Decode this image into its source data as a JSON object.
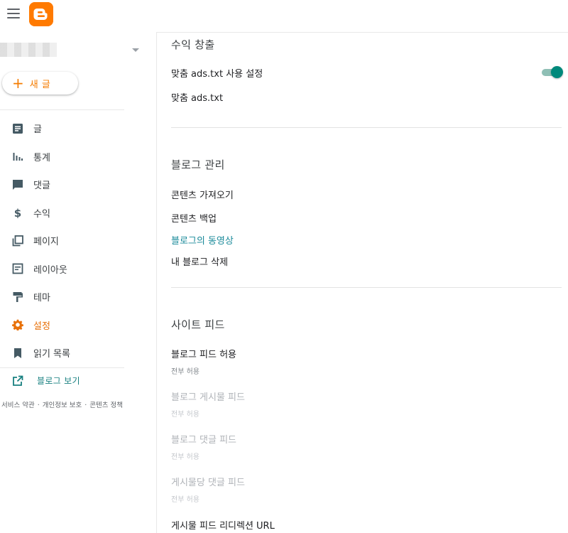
{
  "sidebar": {
    "new_post_label": "새 글",
    "items": [
      {
        "label": "글",
        "icon": "posts-icon"
      },
      {
        "label": "통계",
        "icon": "stats-icon"
      },
      {
        "label": "댓글",
        "icon": "comments-icon"
      },
      {
        "label": "수익",
        "icon": "earnings-icon"
      },
      {
        "label": "페이지",
        "icon": "pages-icon"
      },
      {
        "label": "레이아웃",
        "icon": "layout-icon"
      },
      {
        "label": "테마",
        "icon": "theme-icon"
      },
      {
        "label": "설정",
        "icon": "gear-icon",
        "active": true
      },
      {
        "label": "읽기 목록",
        "icon": "bookmark-icon"
      }
    ],
    "view_blog_label": "블로그 보기",
    "footer": {
      "terms": "서비스 약관",
      "privacy": "개인정보 보호",
      "content_policy": "콘텐츠 정책",
      "separator": "·"
    }
  },
  "colors": {
    "brand": "#ff7a00",
    "active": "#e8710a",
    "link": "#1a8a9a",
    "toggle_on": "#00897b"
  },
  "main": {
    "monetization": {
      "title": "수익 창출",
      "custom_ads_txt_enable": "맞춤 ads.txt 사용 설정",
      "custom_ads_txt_enabled": true,
      "custom_ads_txt": "맞춤 ads.txt"
    },
    "manage_blog": {
      "title": "블로그 관리",
      "import_content": "콘텐츠 가져오기",
      "backup_content": "콘텐츠 백업",
      "blog_videos": "블로그의 동영상",
      "delete_blog": "내 블로그 삭제"
    },
    "site_feed": {
      "title": "사이트 피드",
      "allow_blog_feed": "블로그 피드 허용",
      "allow_blog_feed_value": "전부 허용",
      "post_feed": "블로그 게시물 피드",
      "post_feed_value": "전부 허용",
      "comment_feed": "블로그 댓글 피드",
      "comment_feed_value": "전부 허용",
      "per_post_comment_feed": "게시물당 댓글 피드",
      "per_post_comment_feed_value": "전부 허용",
      "post_feed_redirect_url": "게시물 피드 리디렉션 URL"
    }
  }
}
